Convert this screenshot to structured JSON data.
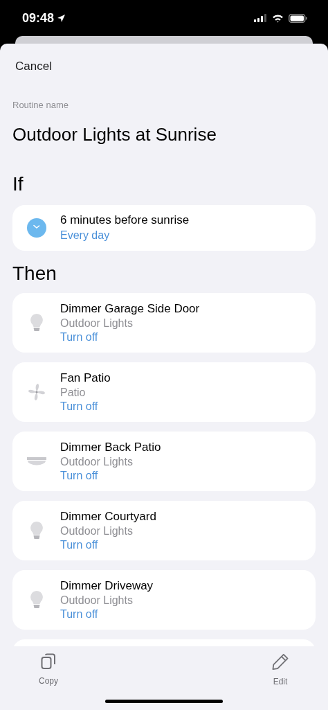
{
  "status_bar": {
    "time": "09:48"
  },
  "cancel": "Cancel",
  "routine_name": {
    "label": "Routine name",
    "value": "Outdoor Lights at Sunrise"
  },
  "if_heading": "If",
  "trigger": {
    "title": "6 minutes before sunrise",
    "repeat": "Every day"
  },
  "then_heading": "Then",
  "actions": [
    {
      "kind": "bulb",
      "name": "Dimmer Garage Side Door",
      "room": "Outdoor Lights",
      "action": "Turn off"
    },
    {
      "kind": "fan",
      "name": "Fan Patio",
      "room": "Patio",
      "action": "Turn off"
    },
    {
      "kind": "ceiling",
      "name": "Dimmer Back Patio",
      "room": "Outdoor Lights",
      "action": "Turn off"
    },
    {
      "kind": "bulb",
      "name": "Dimmer Courtyard",
      "room": "Outdoor Lights",
      "action": "Turn off"
    },
    {
      "kind": "bulb",
      "name": "Dimmer Driveway",
      "room": "Outdoor Lights",
      "action": "Turn off"
    }
  ],
  "toolbar": [
    {
      "kind": "copy",
      "label": "Copy"
    },
    {
      "kind": "edit",
      "label": "Edit"
    }
  ]
}
